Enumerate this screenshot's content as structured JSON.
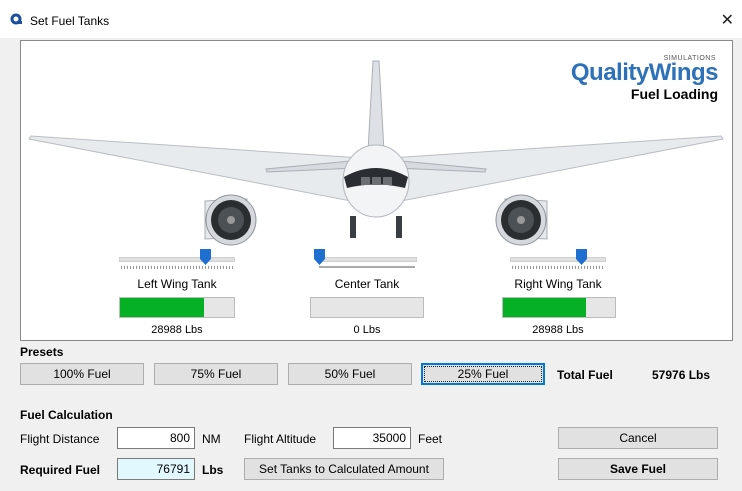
{
  "window": {
    "title": "Set Fuel Tanks",
    "close_symbol": "✕"
  },
  "logo": {
    "small": "SIMULATIONS",
    "main": "QualityWings",
    "subtitle": "Fuel Loading",
    "accent_color": "#2d71b8"
  },
  "tanks": {
    "left": {
      "label": "Left Wing Tank",
      "amount": "28988 Lbs",
      "fill_percent": 74,
      "slider_percent": 74
    },
    "center": {
      "label": "Center Tank",
      "amount": "0 Lbs",
      "fill_percent": 0,
      "slider_percent": 2
    },
    "right": {
      "label": "Right Wing Tank",
      "amount": "28988 Lbs",
      "fill_percent": 74,
      "slider_percent": 74
    }
  },
  "presets": {
    "heading": "Presets",
    "buttons": [
      "100% Fuel",
      "75% Fuel",
      "50% Fuel",
      "25% Fuel"
    ],
    "total_label": "Total Fuel",
    "total_value": "57976 Lbs"
  },
  "calc": {
    "heading": "Fuel Calculation",
    "distance_label": "Flight Distance",
    "distance_value": "800",
    "distance_unit": "NM",
    "altitude_label": "Flight Altitude",
    "altitude_value": "35000",
    "altitude_unit": "Feet",
    "required_label": "Required Fuel",
    "required_value": "76791",
    "required_unit": "Lbs",
    "set_button": "Set Tanks to Calculated Amount"
  },
  "actions": {
    "cancel": "Cancel",
    "save": "Save Fuel"
  },
  "colors": {
    "progress_green": "#06b025",
    "focus_blue": "#0078d7",
    "slider_thumb": "#1e6fd0"
  }
}
